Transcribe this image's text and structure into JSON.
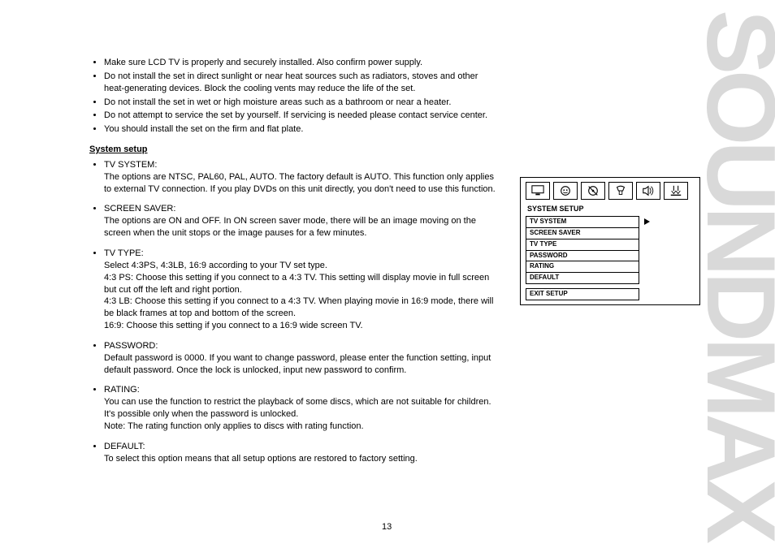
{
  "brand": "SOUNDMAX",
  "bullets_top": [
    "Make sure LCD TV is properly and securely installed. Also confirm power supply.",
    "Do not install the set in direct sunlight or near heat sources such as radiators, stoves and other heat-generating devices. Block the cooling vents may reduce the life of the set.",
    "Do not install the set in wet or high moisture areas such as a bathroom or near a heater.",
    "Do not attempt to service the set by yourself. If servicing is needed please contact service center.",
    "You should install the set on the firm and flat plate."
  ],
  "section_title": "System setup",
  "items": [
    {
      "label": "TV SYSTEM:",
      "desc": "The options are NTSC, PAL60, PAL, AUTO. The factory default is AUTO. This function only applies to external TV connection. If you play DVDs on this unit directly, you don't need to use this function.",
      "extra": ""
    },
    {
      "label": "SCREEN SAVER:",
      "desc": "The options are ON and OFF. In ON screen saver mode, there will be an image moving on the screen when the unit stops or the image pauses for a few minutes."
    },
    {
      "label": "TV TYPE:",
      "desc": "Select 4:3PS, 4:3LB, 16:9 according to your TV set type.",
      "extra_lines": [
        "4:3 PS: Choose this setting if you connect to a 4:3 TV. This setting will display movie in full screen but cut off the left and right portion.",
        "4:3 LB: Choose this setting if you connect to a 4:3 TV. When playing movie in 16:9 mode, there will be black frames at top and bottom of the screen.",
        "16:9: Choose this setting if you connect to a 16:9 wide screen TV."
      ]
    },
    {
      "label": "PASSWORD:",
      "desc": "Default password is 0000. If you want to change password, please enter the function setting, input default password. Once the lock is unlocked, input new password to confirm."
    },
    {
      "label": "RATING:",
      "desc": "You can use the function to restrict the playback of some discs, which are not suitable for children. It's possible only when the password is unlocked.",
      "extra": "Note: The rating function only applies to discs with rating function."
    },
    {
      "label": "DEFAULT:",
      "desc": "To select this option means that all setup options are restored to factory setting."
    }
  ],
  "panel": {
    "title": "SYSTEM SETUP",
    "menu": [
      "TV SYSTEM",
      "SCREEN SAVER",
      "TV TYPE",
      "PASSWORD",
      "RATING",
      "DEFAULT"
    ],
    "exit": "EXIT SETUP"
  },
  "page_number": "13"
}
